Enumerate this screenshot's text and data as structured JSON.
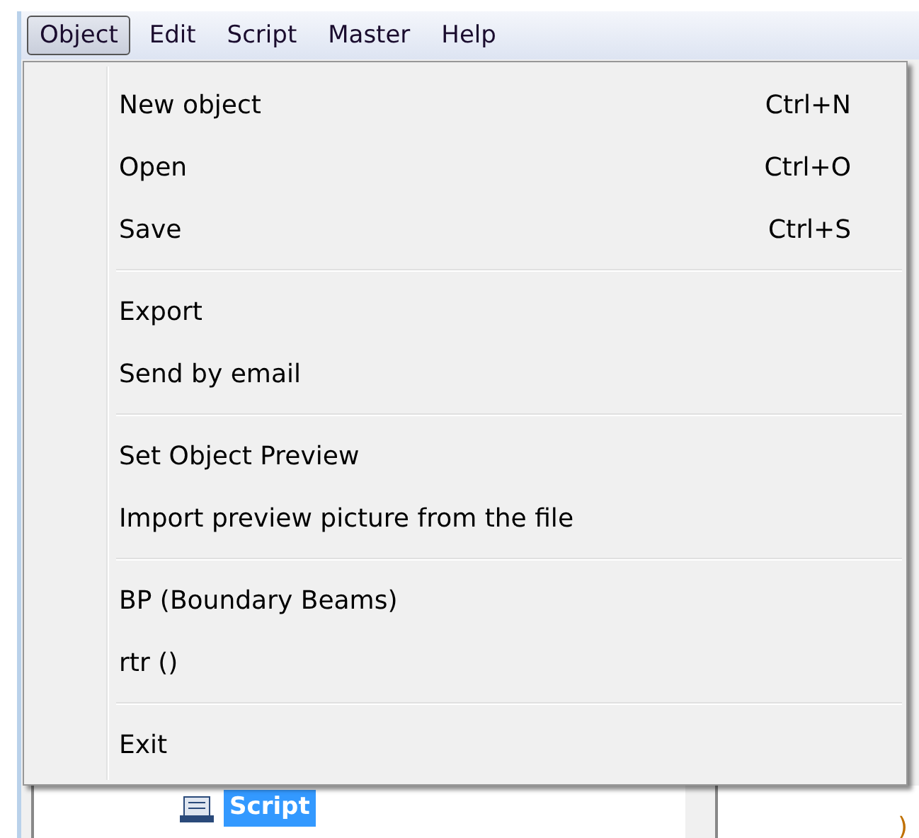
{
  "menubar": [
    {
      "label": "Object",
      "selected": true
    },
    {
      "label": "Edit",
      "selected": false
    },
    {
      "label": "Script",
      "selected": false
    },
    {
      "label": "Master",
      "selected": false
    },
    {
      "label": "Help",
      "selected": false
    }
  ],
  "menu": {
    "groups": [
      [
        {
          "label": "New object",
          "shortcut": "Ctrl+N"
        },
        {
          "label": "Open",
          "shortcut": "Ctrl+O"
        },
        {
          "label": "Save",
          "shortcut": "Ctrl+S"
        }
      ],
      [
        {
          "label": "Export"
        },
        {
          "label": "Send by email"
        }
      ],
      [
        {
          "label": "Set Object Preview"
        },
        {
          "label": "Import preview picture from the file"
        }
      ],
      [
        {
          "label": "BP (Boundary Beams)"
        },
        {
          "label": "rtr ()"
        }
      ],
      [
        {
          "label": "Exit"
        }
      ]
    ]
  },
  "tree": {
    "items": [
      {
        "label": "Script",
        "selected": true
      }
    ]
  },
  "code": {
    "lines": [
      ")"
    ]
  }
}
